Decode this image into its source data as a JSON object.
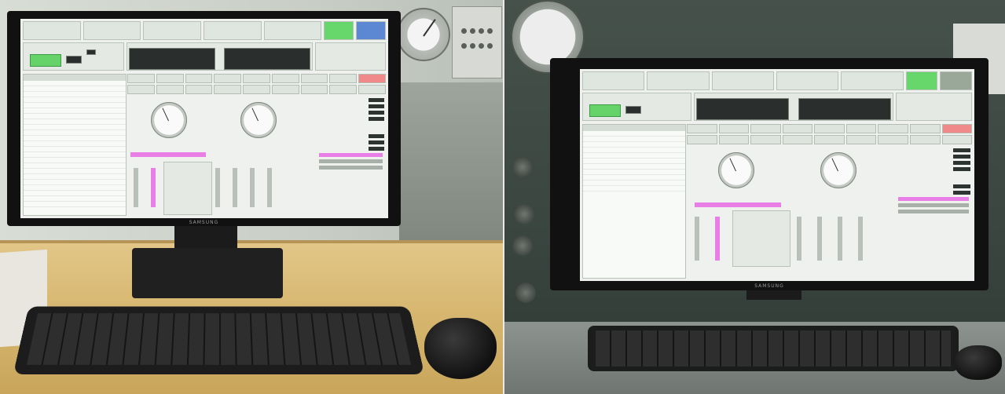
{
  "scene": {
    "description_panels": [
      "left-photo",
      "right-photo"
    ]
  },
  "left": {
    "monitor_brand": "SAMSUNG"
  },
  "right": {
    "monitor_brand": "SAMSUNG"
  },
  "colors": {
    "screen_background": "#eef1ee",
    "status_green": "#66d26a",
    "accent_pink": "#e97fe6",
    "alarm_red": "#f08a8a",
    "desk_wood": "#d6b66e"
  }
}
